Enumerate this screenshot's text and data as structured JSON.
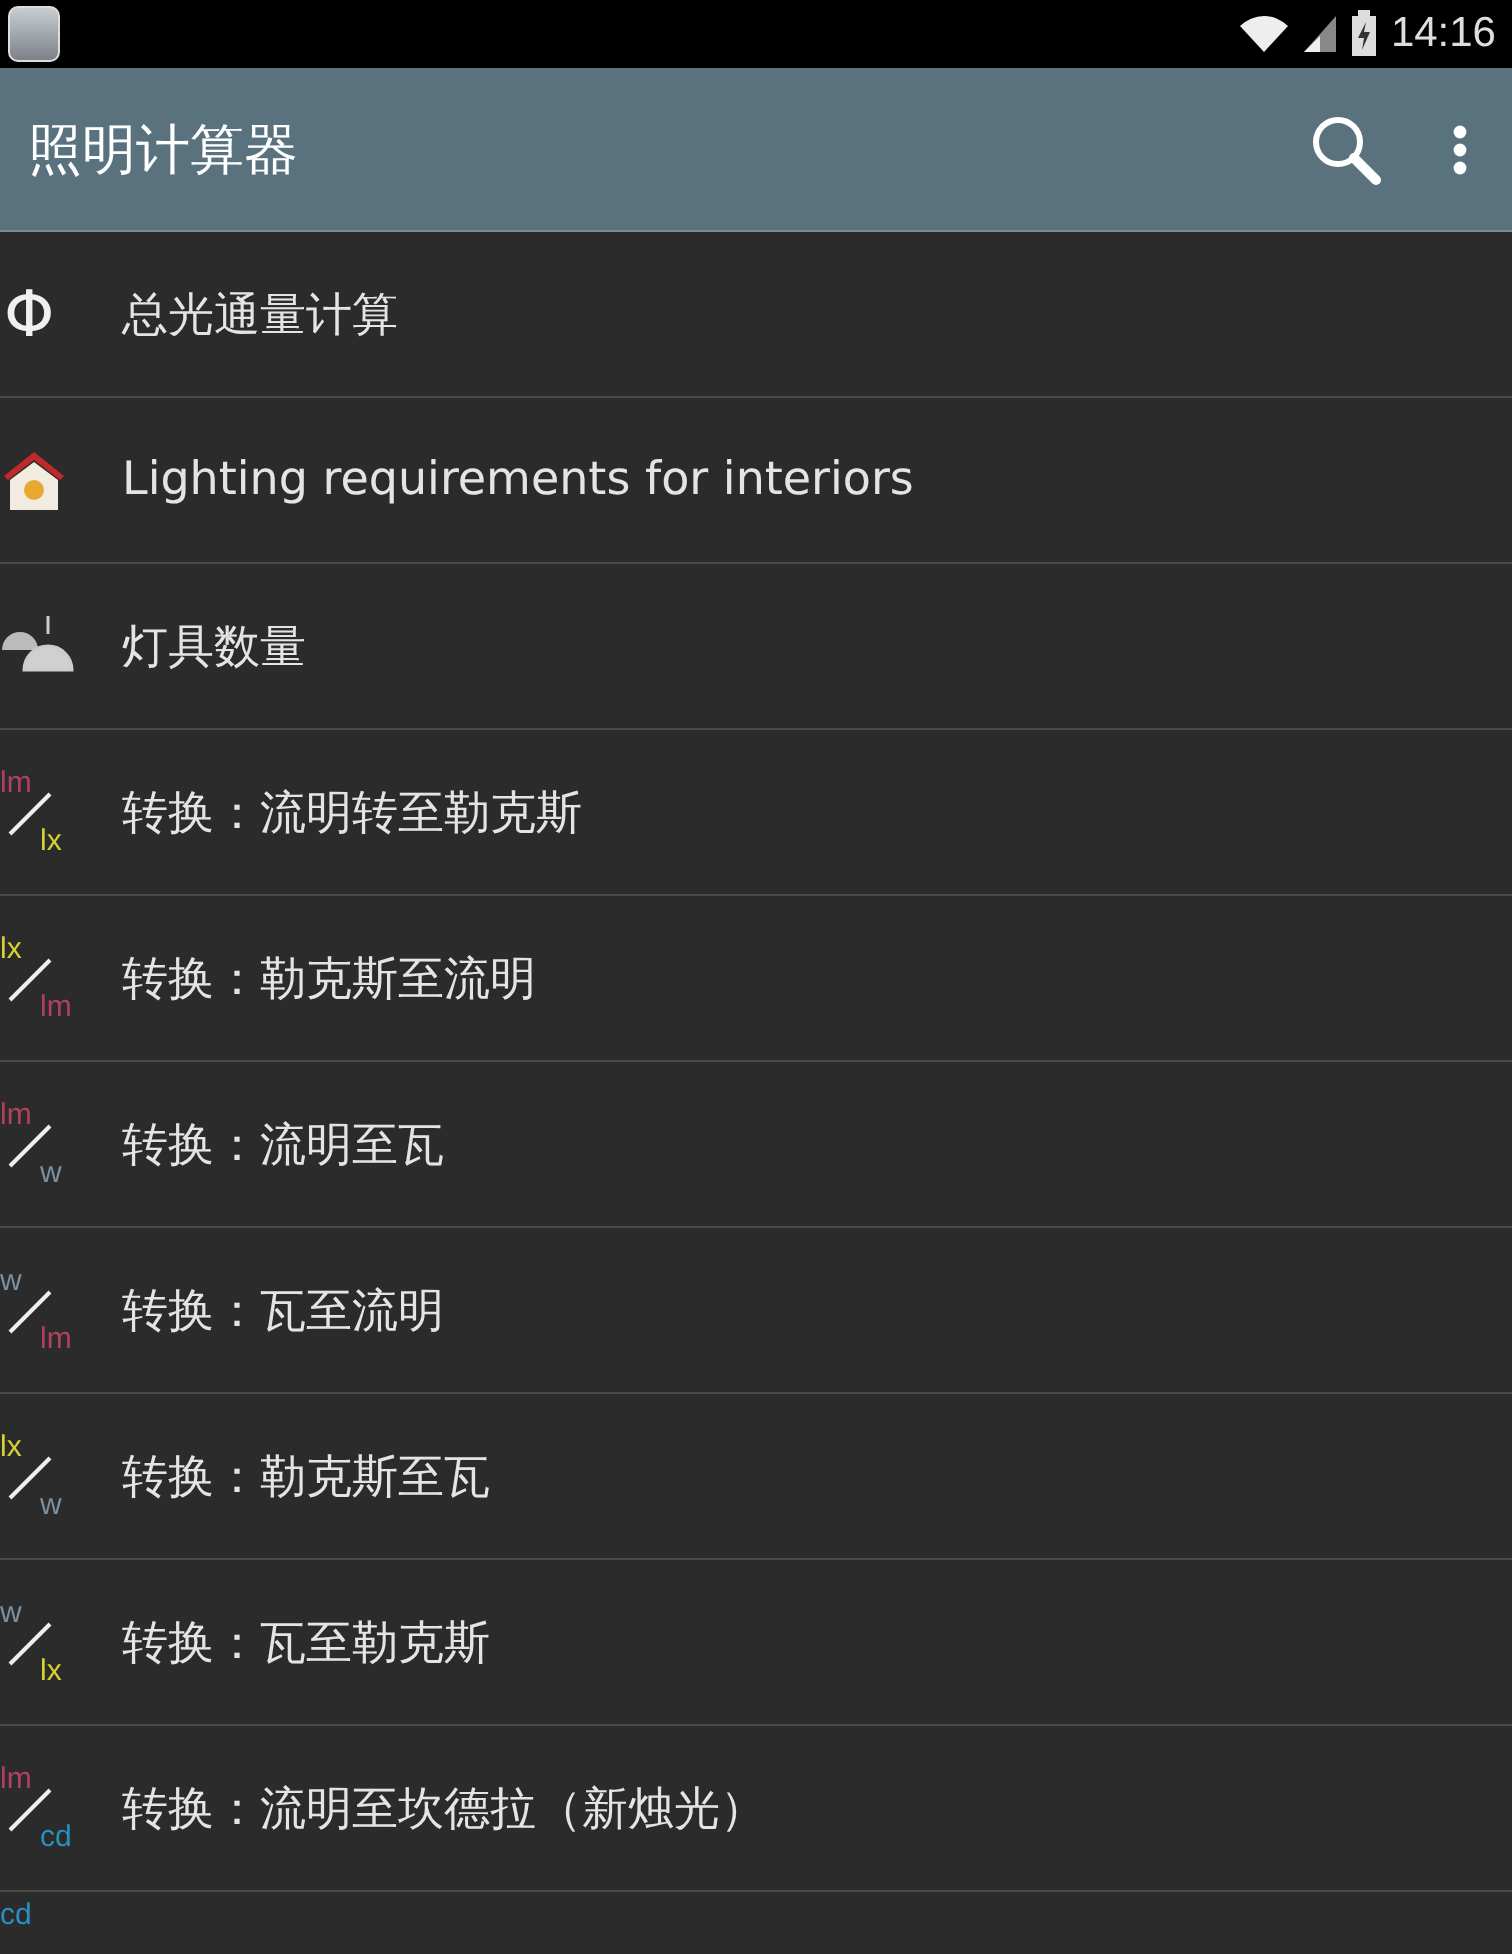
{
  "status_bar": {
    "time": "14:16"
  },
  "app_bar": {
    "title": "照明计算器"
  },
  "items": [
    {
      "kind": "glyph",
      "symbol": "Φ",
      "label": "总光通量计算"
    },
    {
      "kind": "house",
      "label": "Lighting requirements for interiors"
    },
    {
      "kind": "lamps",
      "label": "灯具数量"
    },
    {
      "kind": "units",
      "top": {
        "text": "lm",
        "color": "#b0405f"
      },
      "bottom": {
        "text": "lx",
        "color": "#d6d230"
      },
      "label": "转换：流明转至勒克斯"
    },
    {
      "kind": "units",
      "top": {
        "text": "lx",
        "color": "#d6d230"
      },
      "bottom": {
        "text": "lm",
        "color": "#b0405f"
      },
      "label": "转换：勒克斯至流明"
    },
    {
      "kind": "units",
      "top": {
        "text": "lm",
        "color": "#b0405f"
      },
      "bottom": {
        "text": "w",
        "color": "#7890a0"
      },
      "label": "转换：流明至瓦"
    },
    {
      "kind": "units",
      "top": {
        "text": "w",
        "color": "#7890a0"
      },
      "bottom": {
        "text": "lm",
        "color": "#b0405f"
      },
      "label": "转换：瓦至流明"
    },
    {
      "kind": "units",
      "top": {
        "text": "lx",
        "color": "#d6d230"
      },
      "bottom": {
        "text": "w",
        "color": "#7890a0"
      },
      "label": "转换：勒克斯至瓦"
    },
    {
      "kind": "units",
      "top": {
        "text": "w",
        "color": "#7890a0"
      },
      "bottom": {
        "text": "lx",
        "color": "#d6d230"
      },
      "label": "转换：瓦至勒克斯"
    },
    {
      "kind": "units",
      "top": {
        "text": "lm",
        "color": "#b0405f"
      },
      "bottom": {
        "text": "cd",
        "color": "#2890c0"
      },
      "label": "转换：流明至坎德拉（新烛光）"
    },
    {
      "kind": "units",
      "top": {
        "text": "cd",
        "color": "#2890c0"
      }
    }
  ]
}
